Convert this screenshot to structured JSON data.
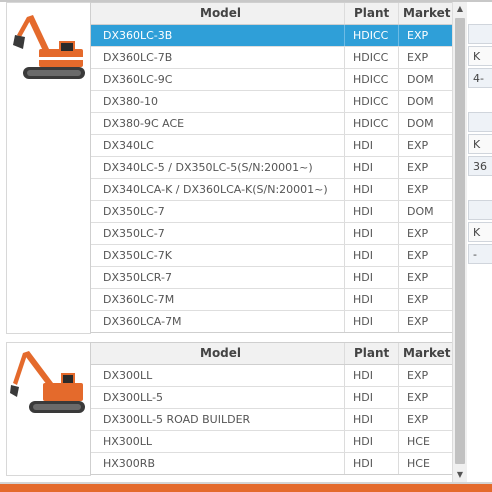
{
  "columns": {
    "model": "Model",
    "plant": "Plant",
    "market": "Market"
  },
  "group1": {
    "rows": [
      {
        "model": "DX360LC-3B",
        "plant": "HDICC",
        "market": "EXP",
        "selected": true
      },
      {
        "model": "DX360LC-7B",
        "plant": "HDICC",
        "market": "EXP"
      },
      {
        "model": "DX360LC-9C",
        "plant": "HDICC",
        "market": "DOM"
      },
      {
        "model": "DX380-10",
        "plant": "HDICC",
        "market": "DOM"
      },
      {
        "model": "DX380-9C ACE",
        "plant": "HDICC",
        "market": "DOM"
      },
      {
        "model": "DX340LC",
        "plant": "HDI",
        "market": "EXP"
      },
      {
        "model": "DX340LC-5 / DX350LC-5(S/N:20001~)",
        "plant": "HDI",
        "market": "EXP"
      },
      {
        "model": "DX340LCA-K / DX360LCA-K(S/N:20001~)",
        "plant": "HDI",
        "market": "EXP"
      },
      {
        "model": "DX350LC-7",
        "plant": "HDI",
        "market": "DOM"
      },
      {
        "model": "DX350LC-7",
        "plant": "HDI",
        "market": "EXP"
      },
      {
        "model": "DX350LC-7K",
        "plant": "HDI",
        "market": "EXP"
      },
      {
        "model": "DX350LCR-7",
        "plant": "HDI",
        "market": "EXP"
      },
      {
        "model": "DX360LC-7M",
        "plant": "HDI",
        "market": "EXP"
      },
      {
        "model": "DX360LCA-7M",
        "plant": "HDI",
        "market": "EXP"
      }
    ]
  },
  "group2": {
    "rows": [
      {
        "model": "DX300LL",
        "plant": "HDI",
        "market": "EXP"
      },
      {
        "model": "DX300LL-5",
        "plant": "HDI",
        "market": "EXP"
      },
      {
        "model": "DX300LL-5 ROAD BUILDER",
        "plant": "HDI",
        "market": "EXP"
      },
      {
        "model": "HX300LL",
        "plant": "HDI",
        "market": "HCE"
      },
      {
        "model": "HX300RB",
        "plant": "HDI",
        "market": "HCE"
      }
    ]
  },
  "right_panel": [
    "",
    "K",
    "4-",
    "",
    "K",
    "36",
    "",
    "K",
    "-"
  ],
  "scrollbar": {
    "up_icon": "triangle-up-icon",
    "down_icon": "triangle-down-icon"
  },
  "colors": {
    "selected_row": "#2f9fd8",
    "excavator_orange": "#e46a2c"
  }
}
